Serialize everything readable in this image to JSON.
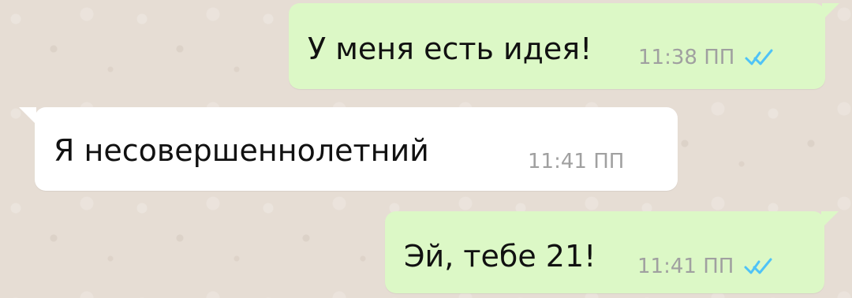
{
  "messages": [
    {
      "text": "У меня есть идея!",
      "time": "11:38 ПП",
      "status_icon": "double-check-icon",
      "direction": "outgoing"
    },
    {
      "text": "Я несовершеннолетний",
      "time": "11:41 ПП",
      "direction": "incoming"
    },
    {
      "text": "Эй, тебе 21!",
      "time": "11:41 ПП",
      "status_icon": "double-check-icon",
      "direction": "outgoing"
    }
  ],
  "colors": {
    "background": "#e6ddd4",
    "outgoing_bubble": "#dcf8c6",
    "incoming_bubble": "#ffffff",
    "text": "#111111",
    "timestamp": "#a0a0a0",
    "read_ticks": "#4fc3f7"
  }
}
